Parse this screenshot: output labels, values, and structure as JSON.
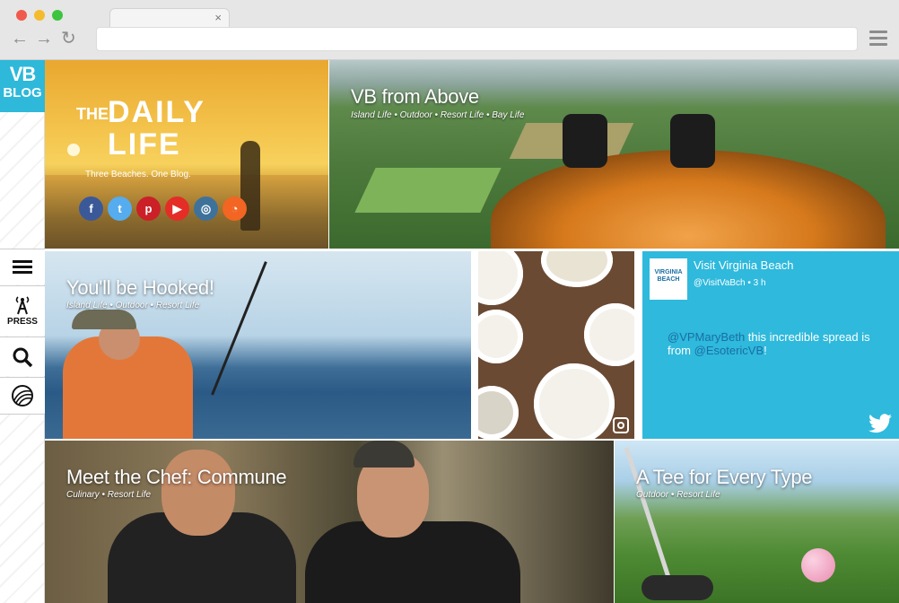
{
  "browser": {
    "tab_close": "×",
    "back": "←",
    "forward": "→",
    "reload": "↻",
    "url": ""
  },
  "sidebar": {
    "logo_line1": "VB",
    "logo_line2": "BLOG",
    "press_label": "PRESS"
  },
  "daily": {
    "title_the": "THE",
    "title_main": "DAILY\nLIFE",
    "tagline": "Three Beaches. One Blog.",
    "social": [
      {
        "icon": "facebook-icon",
        "glyph": "f",
        "color": "#3b5998"
      },
      {
        "icon": "twitter-icon",
        "glyph": "t",
        "color": "#55acee"
      },
      {
        "icon": "pinterest-icon",
        "glyph": "p",
        "color": "#cb2027"
      },
      {
        "icon": "youtube-icon",
        "glyph": "▶",
        "color": "#e52d27"
      },
      {
        "icon": "instagram-icon",
        "glyph": "◎",
        "color": "#3f729b"
      },
      {
        "icon": "rss-icon",
        "glyph": "◔",
        "color": "#f26522"
      }
    ]
  },
  "tiles": {
    "above": {
      "title": "VB from Above",
      "subtitle": "Island Life • Outdoor • Resort Life • Bay Life"
    },
    "hooked": {
      "title": "You'll be Hooked!",
      "subtitle": "Island Life • Outdoor • Resort Life"
    },
    "chef": {
      "title": "Meet the Chef: Commune",
      "subtitle": "Culinary • Resort Life"
    },
    "golf": {
      "title": "A Tee for Every Type",
      "subtitle": "Outdoor • Resort Life"
    }
  },
  "tweet": {
    "avatar_text": "VIRGINIA BEACH",
    "name": "Visit Virginia Beach",
    "handle": "@VisitVaBch • 3 h",
    "mention1": "@VPMaryBeth",
    "text_mid": " this incredible spread is from ",
    "mention2": "@EsotericVB",
    "text_end": "!"
  }
}
